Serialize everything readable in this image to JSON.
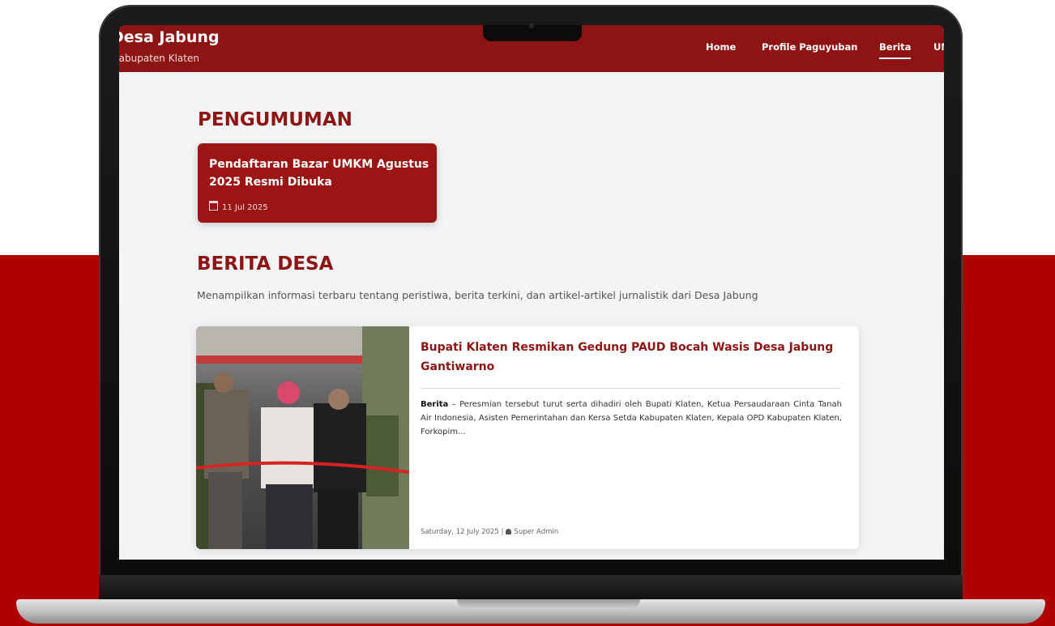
{
  "header": {
    "site_title": "Desa Jabung",
    "site_subtitle": "Kabupaten Klaten",
    "nav": [
      {
        "label": "Home"
      },
      {
        "label": "Profile Paguyuban"
      },
      {
        "label": "Berita",
        "active": true
      },
      {
        "label": "UMKM"
      }
    ]
  },
  "announcements": {
    "heading": "PENGUMUMAN",
    "items": [
      {
        "title": "Pendaftaran Bazar UMKM Agustus 2025 Resmi Dibuka",
        "date": "11 Jul 2025"
      }
    ]
  },
  "news": {
    "heading": "BERITA DESA",
    "description": "Menampilkan informasi terbaru tentang peristiwa, berita terkini, dan artikel-artikel jurnalistik dari Desa Jabung",
    "items": [
      {
        "title": "Bupati Klaten Resmikan Gedung PAUD Bocah Wasis Desa Jabung Gantiwarno",
        "category": "Berita",
        "excerpt": " – Peresmian tersebut turut serta dihadiri oleh Bupati Klaten, Ketua Persaudaraan Cinta Tanah Air Indonesia, Asisten Pemerintahan dan Kersa Setda Kabupaten Klaten, Kepala OPD Kabupaten Klaten, Forkopim...",
        "date": "Saturday, 12 July 2025 |",
        "author": "Super Admin"
      }
    ]
  },
  "colors": {
    "brand_red": "#8e1414",
    "backdrop_red": "#b10000",
    "page_background": "#f3f4f6"
  },
  "icons": {
    "calendar": "calendar-icon",
    "user": "user-icon"
  }
}
